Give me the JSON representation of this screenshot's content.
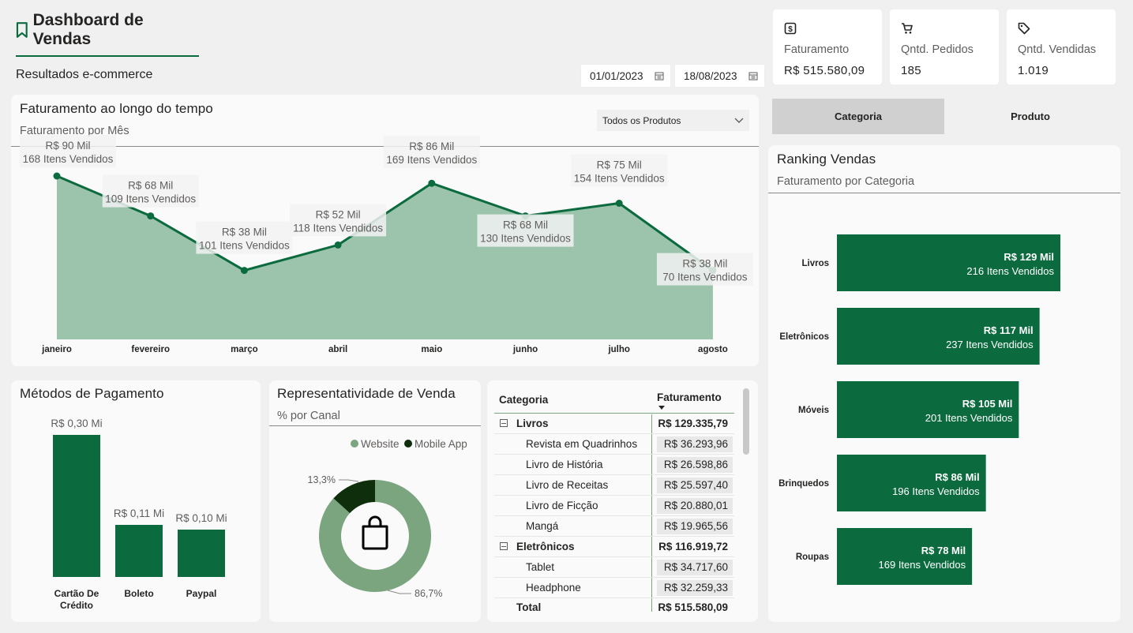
{
  "header": {
    "title": "Dashboard de Vendas",
    "subtitle": "Resultados e-commerce",
    "date_start": "01/01/2023",
    "date_end": "18/08/2023"
  },
  "kpis": [
    {
      "label": "Faturamento",
      "value": "R$ 515.580,09",
      "icon": "dollar-icon"
    },
    {
      "label": "Qntd. Pedidos",
      "value": "185",
      "icon": "cart-icon"
    },
    {
      "label": "Qntd. Vendidas",
      "value": "1.019",
      "icon": "tag-icon"
    }
  ],
  "toggle": {
    "categoria": "Categoria",
    "produto": "Produto",
    "active": "categoria"
  },
  "timeline": {
    "title": "Faturamento ao longo do tempo",
    "subtitle": "Faturamento por Mês",
    "dropdown": "Todos os Produtos"
  },
  "payment": {
    "title": "Métodos de Pagamento"
  },
  "channel": {
    "title": "Representatividade de Venda",
    "subtitle": "% por Canal"
  },
  "ranking": {
    "title": "Ranking Vendas",
    "subtitle": "Faturamento por Categoria"
  },
  "colors": {
    "primary": "#0b6b3e",
    "area": "#9cc3ab",
    "website": "#7aa57f",
    "mobile": "#0e2e0c",
    "toggle_active": "#d0d0d0"
  },
  "chart_data": [
    {
      "type": "area",
      "name": "faturamento-mensal",
      "categories": [
        "janeiro",
        "fevereiro",
        "março",
        "abril",
        "maio",
        "junho",
        "julho",
        "agosto"
      ],
      "values": [
        90,
        68,
        38,
        52,
        86,
        68,
        75,
        38
      ],
      "labels": [
        "R$ 90 Mil",
        "R$ 68 Mil",
        "R$ 38 Mil",
        "R$ 52 Mil",
        "R$ 86 Mil",
        "R$ 68 Mil",
        "R$ 75 Mil",
        "R$ 38 Mil"
      ],
      "items": [
        "168 Itens Vendidos",
        "109 Itens Vendidos",
        "101 Itens Vendidos",
        "118 Itens Vendidos",
        "169 Itens Vendidos",
        "130 Itens Vendidos",
        "154 Itens Vendidos",
        "70 Itens Vendidos"
      ],
      "ylim": [
        0,
        100
      ]
    },
    {
      "type": "bar",
      "name": "metodos-pagamento",
      "categories": [
        "Cartão De Crédito",
        "Boleto",
        "Paypal"
      ],
      "values": [
        0.3,
        0.11,
        0.1
      ],
      "labels": [
        "R$ 0,30 Mi",
        "R$ 0,11 Mi",
        "R$ 0,10 Mi"
      ],
      "ylim": [
        0,
        0.34
      ]
    },
    {
      "type": "pie",
      "name": "canal",
      "legend": [
        "Website",
        "Mobile App"
      ],
      "values": [
        86.7,
        13.3
      ],
      "labels": [
        "86,7%",
        "13,3%"
      ]
    },
    {
      "type": "table",
      "name": "categoria-faturamento",
      "columns": [
        "Categoria",
        "Faturamento"
      ],
      "rows": [
        {
          "name": "Livros",
          "value": "R$ 129.335,79",
          "level": 0
        },
        {
          "name": "Revista em Quadrinhos",
          "value": "R$ 36.293,96",
          "level": 1
        },
        {
          "name": "Livro de História",
          "value": "R$ 26.598,86",
          "level": 1
        },
        {
          "name": "Livro de Receitas",
          "value": "R$ 25.597,40",
          "level": 1
        },
        {
          "name": "Livro de Ficção",
          "value": "R$ 20.880,01",
          "level": 1
        },
        {
          "name": "Mangá",
          "value": "R$ 19.965,56",
          "level": 1
        },
        {
          "name": "Eletrônicos",
          "value": "R$ 116.919,72",
          "level": 0
        },
        {
          "name": "Tablet",
          "value": "R$ 34.717,60",
          "level": 1
        },
        {
          "name": "Headphone",
          "value": "R$ 32.259,33",
          "level": 1
        }
      ],
      "total": {
        "name": "Total",
        "value": "R$ 515.580,09"
      }
    },
    {
      "type": "bar",
      "name": "ranking-vendas",
      "orientation": "horizontal",
      "categories": [
        "Livros",
        "Eletrônicos",
        "Móveis",
        "Brinquedos",
        "Roupas"
      ],
      "values": [
        129,
        117,
        105,
        86,
        78
      ],
      "labels": [
        "R$ 129 Mil",
        "R$ 117 Mil",
        "R$ 105 Mil",
        "R$ 86 Mil",
        "R$ 78 Mil"
      ],
      "items": [
        "216 Itens Vendidos",
        "237 Itens Vendidos",
        "201 Itens Vendidos",
        "196 Itens Vendidos",
        "169 Itens Vendidos"
      ]
    }
  ]
}
